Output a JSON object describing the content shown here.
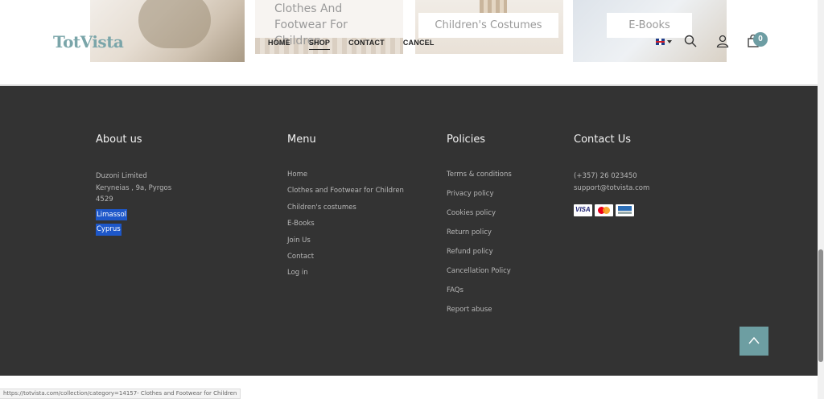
{
  "header": {
    "logo_text": "TotVista",
    "nav": [
      "HOME",
      "SHOP",
      "CONTACT",
      "CANCEL"
    ],
    "active_nav": "SHOP",
    "cart_count": "0",
    "language_flag": "uk-flag-icon"
  },
  "categories": {
    "clothes_title": "Clothes And Footwear For Children",
    "costumes_label": "Children's Costumes",
    "ebooks_label": "E-Books"
  },
  "footer": {
    "about": {
      "heading": "About us",
      "lines": [
        "Duzoni Limited",
        "Keryneias , 9a, Pyrgos",
        "4529",
        "Limassol",
        "Cyprus"
      ]
    },
    "menu": {
      "heading": "Menu",
      "links": [
        "Home",
        "Clothes and Footwear for Children",
        "Children's costumes",
        "E-Books",
        "Join Us",
        "Contact",
        "Log in"
      ]
    },
    "policies": {
      "heading": "Policies",
      "links": [
        "Terms & conditions",
        "Privacy policy",
        "Cookies policy",
        "Return policy",
        "Refund policy",
        "Cancellation Policy",
        "FAQs",
        "Report abuse"
      ]
    },
    "contact": {
      "heading": "Contact Us",
      "phone": "(+357) 26 023450",
      "email": "support@totvista.com",
      "payment_icons": [
        "visa-icon",
        "mastercard-icon",
        "bank-card-icon"
      ]
    }
  },
  "status_bar": {
    "url": "https://totvista.com/collection/category=14157- Clothes and Footwear for Children"
  },
  "colors": {
    "footer_bg": "#333333",
    "accent": "#6d9ea2",
    "selection": "#1d57c9"
  }
}
